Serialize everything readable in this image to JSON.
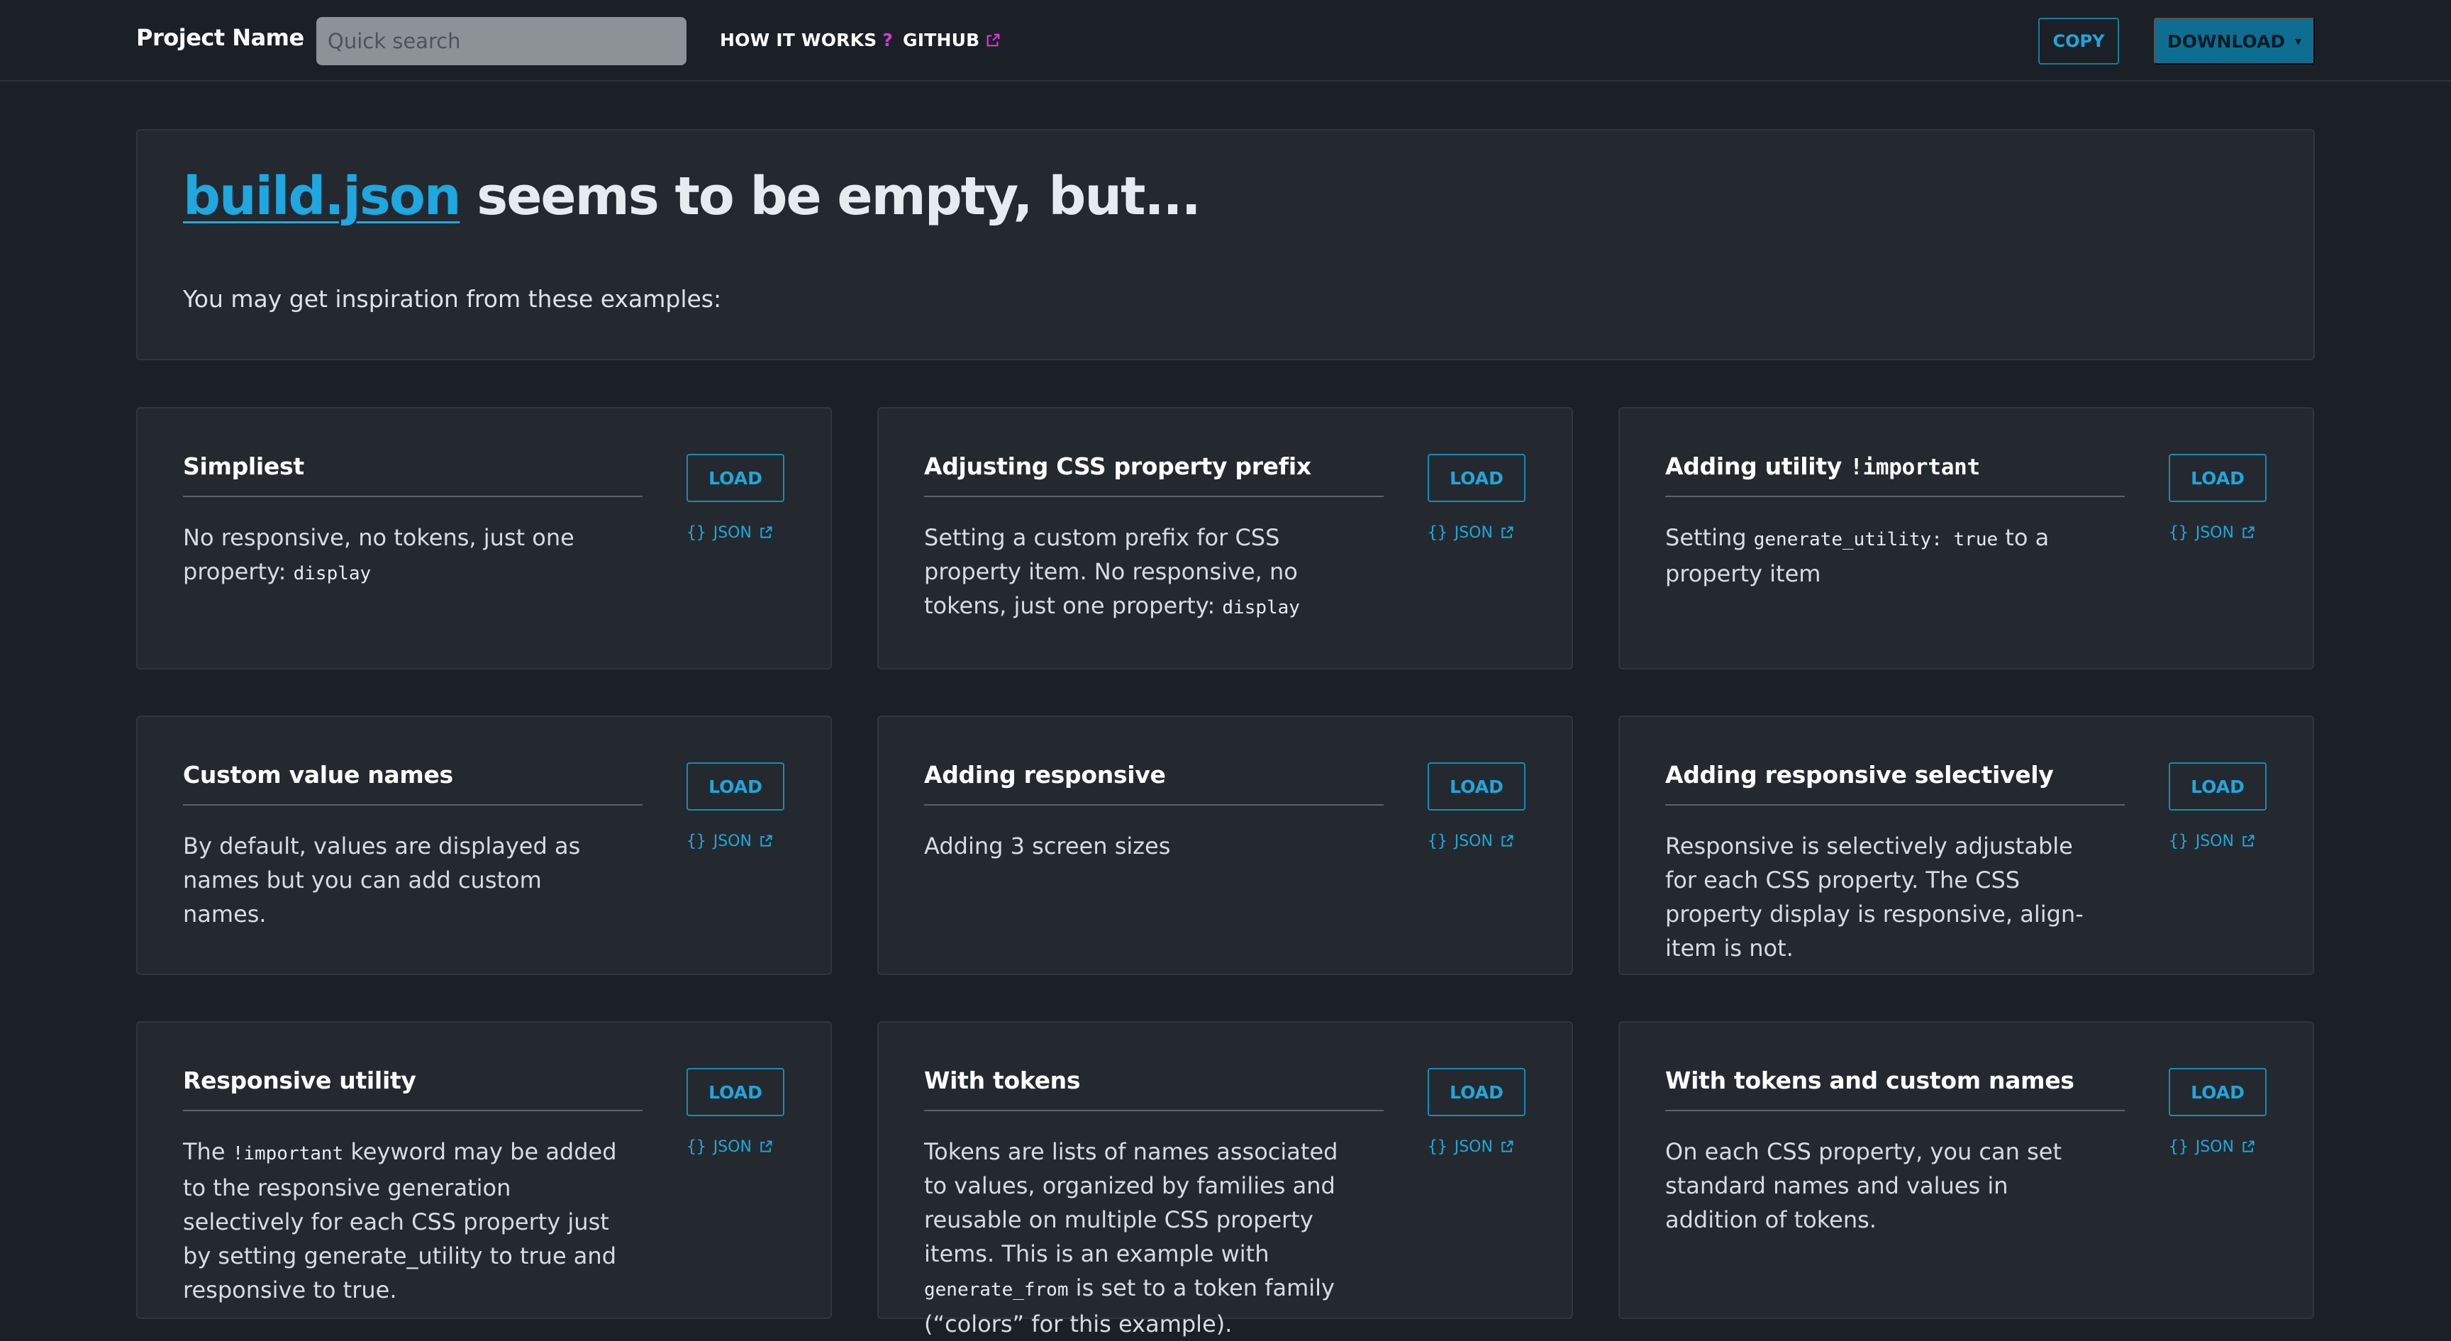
{
  "header": {
    "brand": "Project Name",
    "search_placeholder": "Quick search",
    "nav": {
      "how_it_works": "HOW IT WORKS",
      "how_it_works_mark": "?",
      "github": "GITHUB"
    },
    "copy_label": "COPY",
    "download_label": "DOWNLOAD",
    "download_caret": "▾"
  },
  "hero": {
    "file_link": "build.json",
    "title_rest": " seems to be empty, but...",
    "subtitle": "You may get inspiration from these examples:"
  },
  "examples": {
    "load_label": "LOAD",
    "json_braces": "{}",
    "json_label": "JSON",
    "items": [
      {
        "title": "Simpliest",
        "desc_parts": [
          [
            "text",
            "No responsive, no tokens, just one property: "
          ],
          [
            "code",
            "display"
          ]
        ]
      },
      {
        "title": "Adjusting CSS property prefix",
        "desc_parts": [
          [
            "text",
            "Setting a custom prefix for CSS property item. No responsive, no tokens, just one property: "
          ],
          [
            "code",
            "display"
          ]
        ]
      },
      {
        "title_parts": [
          [
            "text",
            "Adding utility "
          ],
          [
            "code",
            "!important"
          ]
        ],
        "desc_parts": [
          [
            "text",
            "Setting "
          ],
          [
            "code",
            "generate_utility: true"
          ],
          [
            "text",
            " to a property item"
          ]
        ]
      },
      {
        "title": "Custom value names",
        "desc_parts": [
          [
            "text",
            "By default, values are displayed as names but you can add custom names."
          ]
        ]
      },
      {
        "title": "Adding responsive",
        "desc_parts": [
          [
            "text",
            "Adding 3 screen sizes"
          ]
        ]
      },
      {
        "title": "Adding responsive selectively",
        "desc_parts": [
          [
            "text",
            "Responsive is selectively adjustable for each CSS property. The CSS property display is responsive, align-item is not."
          ]
        ]
      },
      {
        "title": "Responsive utility",
        "desc_parts": [
          [
            "text",
            "The "
          ],
          [
            "code",
            "!important"
          ],
          [
            "text",
            " keyword may be added to the responsive generation selectively for each CSS property just by setting generate_utility to true and responsive to true."
          ]
        ]
      },
      {
        "title": "With tokens",
        "desc_parts": [
          [
            "text",
            "Tokens are lists of names associated to values, organized by families and reusable on multiple CSS property items. This is an example with "
          ],
          [
            "code",
            "generate_from"
          ],
          [
            "text",
            " is set to a token family (“colors” for this example)."
          ]
        ]
      },
      {
        "title": "With tokens and custom names",
        "desc_parts": [
          [
            "text",
            "On each CSS property, you can set standard names and values in addition of tokens."
          ]
        ]
      }
    ]
  },
  "colors": {
    "background": "#1b2027",
    "card": "#23292f",
    "accent": "#22a6d8",
    "download_bg": "#0d6e92",
    "help_mark": "#d63bd0"
  }
}
